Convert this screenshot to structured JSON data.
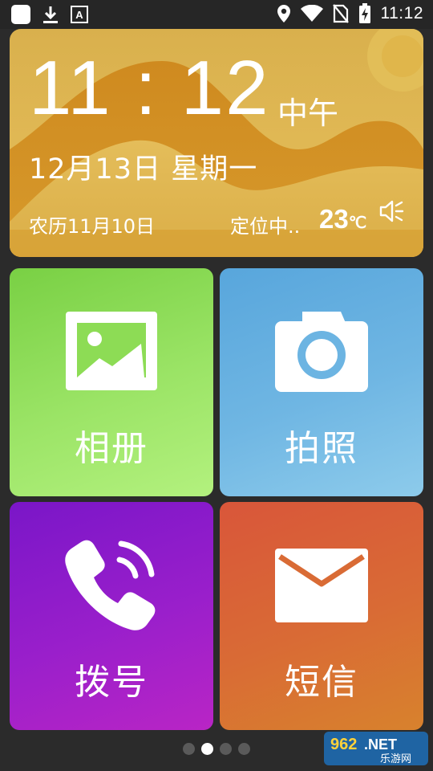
{
  "status_bar": {
    "time": "11:12",
    "left_icons": [
      "app-icon",
      "download-icon",
      "font-icon"
    ],
    "right_icons": [
      "location-icon",
      "wifi-icon",
      "no-sim-icon",
      "battery-charging-icon"
    ]
  },
  "widget": {
    "clock": "11 : 12",
    "ampm": "中午",
    "date": "12月13日  星期一",
    "lunar": "农历11月10日",
    "location": "定位中..",
    "temperature": "23",
    "temperature_unit": "℃"
  },
  "tiles": [
    {
      "label": "相册",
      "icon": "image-icon",
      "color": "#8ddc55"
    },
    {
      "label": "拍照",
      "icon": "camera-icon",
      "color": "#6cb4e2"
    },
    {
      "label": "拨号",
      "icon": "phone-icon",
      "color": "#9a1fcb"
    },
    {
      "label": "短信",
      "icon": "envelope-icon",
      "color": "#d96b35"
    }
  ],
  "pager": {
    "pages": 4,
    "current": 2
  },
  "watermark": {
    "line1": "962.NET",
    "line2": "乐游网"
  }
}
